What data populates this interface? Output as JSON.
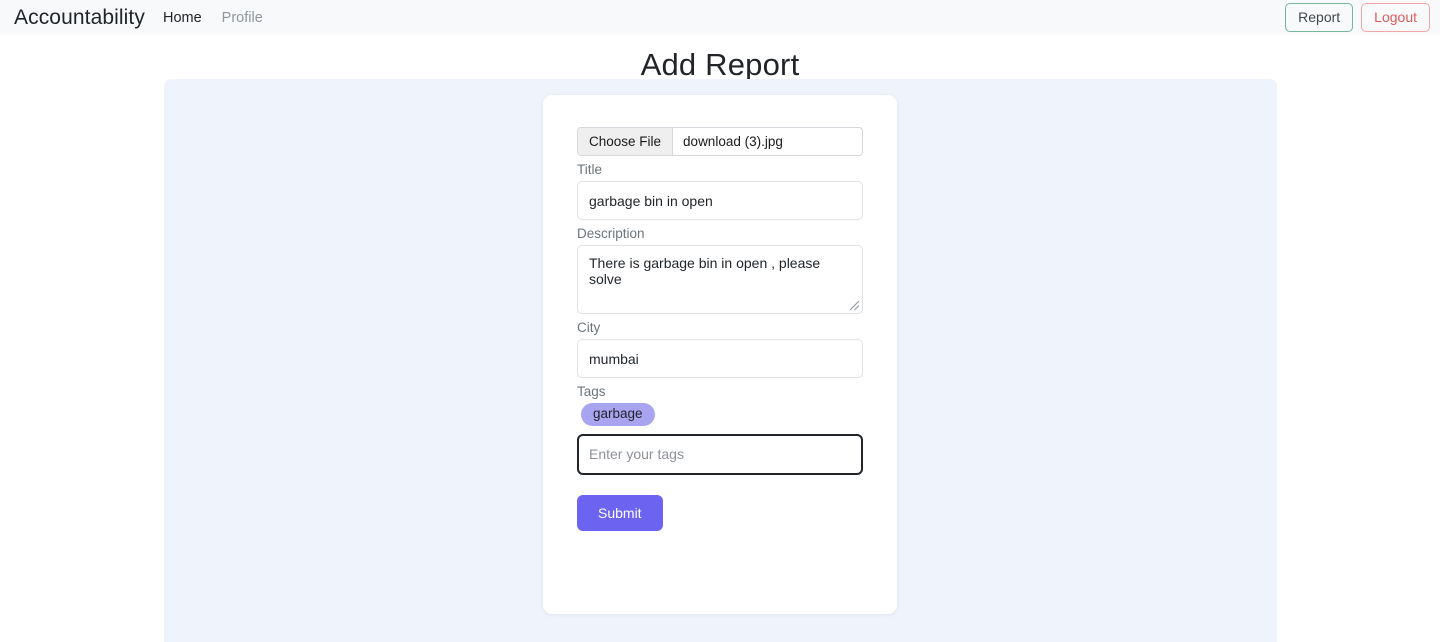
{
  "navbar": {
    "brand": "Accountability",
    "links": [
      {
        "label": "Home",
        "muted": false
      },
      {
        "label": "Profile",
        "muted": true
      }
    ],
    "actions": {
      "report_label": "Report",
      "logout_label": "Logout",
      "report_border_color": "#74b79a",
      "logout_border_color": "#f2a6a6",
      "logout_text_color": "#e05a5a"
    },
    "background": "#f8f9fa"
  },
  "page": {
    "title": "Add Report",
    "panel_background": "#eff3fc",
    "card_background": "#ffffff"
  },
  "form": {
    "file": {
      "button_label": "Choose File",
      "file_name": "download (3).jpg"
    },
    "title": {
      "label": "Title",
      "value": "garbage bin in open",
      "placeholder": ""
    },
    "description": {
      "label": "Description",
      "value": "There is garbage bin in open , please solve",
      "placeholder": ""
    },
    "city": {
      "label": "City",
      "value": "mumbai",
      "placeholder": ""
    },
    "tags": {
      "label": "Tags",
      "chips": [
        "garbage"
      ],
      "chip_color": "#a9a4f0",
      "input_value": "",
      "placeholder": "Enter your tags",
      "focused_border_color": "#212529"
    },
    "submit": {
      "label": "Submit",
      "color": "#6c63f0"
    }
  },
  "icons": {
    "resize_grip": "resize-grip-icon"
  }
}
